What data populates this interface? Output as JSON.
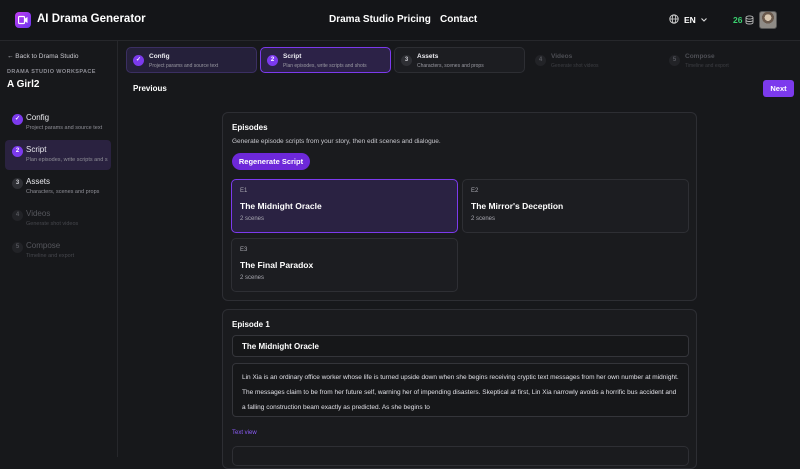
{
  "header": {
    "brand": "AI Drama Generator",
    "nav": [
      "Drama Studio",
      "Pricing",
      "Contact"
    ],
    "language": "EN",
    "credits": "26",
    "icons": {
      "globe": "globe-icon",
      "chevron": "chevron-down-icon",
      "coin": "coin-icon"
    }
  },
  "sidebar": {
    "back": "← Back to Drama Studio",
    "workspace_label": "DRAMA STUDIO WORKSPACE",
    "project": "A Girl2",
    "steps": [
      {
        "num": "✓",
        "title": "Config",
        "sub": "Project params and source text"
      },
      {
        "num": "2",
        "title": "Script",
        "sub": "Plan episodes, write scripts and shots"
      },
      {
        "num": "3",
        "title": "Assets",
        "sub": "Characters, scenes and props"
      },
      {
        "num": "4",
        "title": "Videos",
        "sub": "Generate shot videos"
      },
      {
        "num": "5",
        "title": "Compose",
        "sub": "Timeline and export"
      }
    ]
  },
  "stepper": [
    {
      "num": "✓",
      "title": "Config",
      "sub": "Project params and source text"
    },
    {
      "num": "2",
      "title": "Script",
      "sub": "Plan episodes, write scripts and shots"
    },
    {
      "num": "3",
      "title": "Assets",
      "sub": "Characters, scenes and props"
    },
    {
      "num": "4",
      "title": "Videos",
      "sub": "Generate shot videos"
    },
    {
      "num": "5",
      "title": "Compose",
      "sub": "Timeline and export"
    }
  ],
  "controls": {
    "previous": "Previous",
    "next": "Next"
  },
  "episodes_panel": {
    "heading": "Episodes",
    "subtitle": "Generate episode scripts from your story, then edit scenes and dialogue.",
    "regenerate": "Regenerate Script",
    "episodes": [
      {
        "num": "E1",
        "title": "The Midnight Oracle",
        "scenes": "2 scenes"
      },
      {
        "num": "E2",
        "title": "The Mirror's Deception",
        "scenes": "2 scenes"
      },
      {
        "num": "E3",
        "title": "The Final Paradox",
        "scenes": "2 scenes"
      }
    ]
  },
  "episode_detail": {
    "heading": "Episode 1",
    "title_value": "The Midnight Oracle",
    "synopsis": "Lin Xia is an ordinary office worker whose life is turned upside down when she begins receiving cryptic text messages from her own number at midnight. The messages claim to be from her future self, warning her of impending disasters. Skeptical at first, Lin Xia narrowly avoids a horrific bus accident and a falling construction beam exactly as predicted. As she begins to",
    "text_view": "Text view"
  },
  "colors": {
    "accent": "#7c3aed",
    "credits": "#3ad06f",
    "background": "#17181b"
  }
}
